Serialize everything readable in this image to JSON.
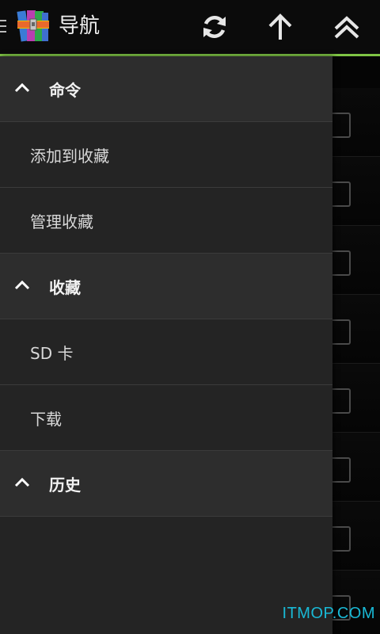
{
  "action_bar": {
    "title": "导航",
    "accent_color": "#7fc545",
    "icons": [
      "drawer-indicator-icon",
      "app-logo-icon",
      "refresh-icon",
      "arrow-up-icon",
      "double-chevron-up-icon"
    ]
  },
  "drawer": {
    "sections": [
      {
        "label": "命令",
        "icon": "chevron-up-icon",
        "items": [
          {
            "label": "添加到收藏"
          },
          {
            "label": "管理收藏"
          }
        ]
      },
      {
        "label": "收藏",
        "icon": "chevron-up-icon",
        "items": [
          {
            "label": "SD 卡"
          },
          {
            "label": "下载"
          }
        ]
      },
      {
        "label": "历史",
        "icon": "chevron-up-icon",
        "items": []
      }
    ]
  },
  "background_list": {
    "row_count": 8
  },
  "watermark": {
    "text": "ITMOP.COM",
    "color": "#19b9d6"
  }
}
